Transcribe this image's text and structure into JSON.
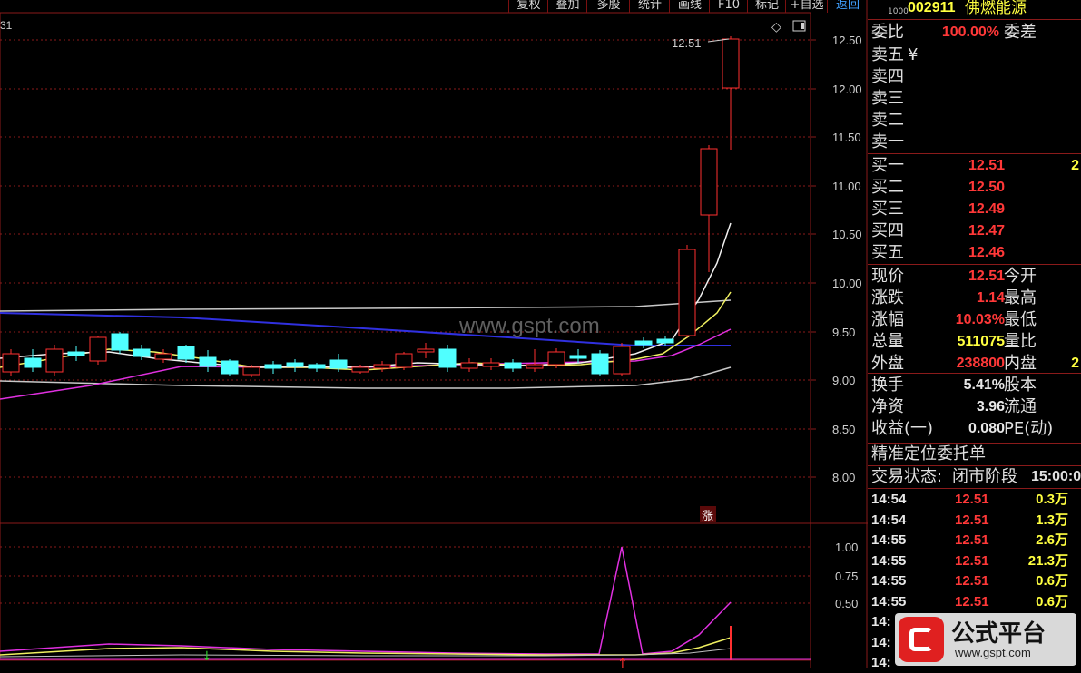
{
  "toolbar": {
    "buttons": [
      "复权",
      "叠加",
      "多股",
      "统计",
      "画线",
      "F10",
      "标记",
      "+自选",
      "返回"
    ]
  },
  "chart": {
    "corner_label": "31",
    "price_ticks": [
      "12.50",
      "12.00",
      "11.50",
      "11.00",
      "10.50",
      "10.00",
      "9.50",
      "9.00",
      "8.50",
      "8.00"
    ],
    "indicator_ticks": [
      "1.00",
      "0.75",
      "0.50"
    ],
    "high_label": "12.51",
    "limit_up_marker": "涨",
    "watermark": "www.gspt.com",
    "colors": {
      "up": "#ff3030",
      "down": "#50ffff",
      "grid": "#8a1a1a"
    }
  },
  "stock": {
    "code_prefix": "1000",
    "code": "002911",
    "name": "佛燃能源"
  },
  "ratio": {
    "label": "委比",
    "value": "100.00%",
    "label2": "委差"
  },
  "sell": [
    {
      "label": "卖五",
      "extra": "¥"
    },
    {
      "label": "卖四",
      "extra": ""
    },
    {
      "label": "卖三",
      "extra": ""
    },
    {
      "label": "卖二",
      "extra": ""
    },
    {
      "label": "卖一",
      "extra": ""
    }
  ],
  "buy": [
    {
      "label": "买一",
      "price": "12.51",
      "vol": "2"
    },
    {
      "label": "买二",
      "price": "12.50",
      "vol": ""
    },
    {
      "label": "买三",
      "price": "12.49",
      "vol": ""
    },
    {
      "label": "买四",
      "price": "12.47",
      "vol": ""
    },
    {
      "label": "买五",
      "price": "12.46",
      "vol": ""
    }
  ],
  "quote": [
    {
      "label": "现价",
      "value": "12.51",
      "label2": "今开",
      "color": "red"
    },
    {
      "label": "涨跌",
      "value": "1.14",
      "label2": "最高",
      "color": "red"
    },
    {
      "label": "涨幅",
      "value": "10.03%",
      "label2": "最低",
      "color": "red"
    },
    {
      "label": "总量",
      "value": "511075",
      "label2": "量比",
      "color": "yellow"
    },
    {
      "label": "外盘",
      "value": "238800",
      "label2": "内盘",
      "color": "red",
      "extra": "2"
    }
  ],
  "fund": [
    {
      "label": "换手",
      "value": "5.41%",
      "label2": "股本"
    },
    {
      "label": "净资",
      "value": "3.96",
      "label2": "流通"
    },
    {
      "label": "收益(一)",
      "value": "0.080",
      "label2": "PE(动)"
    }
  ],
  "order_panel": {
    "title": "精准定位委托单"
  },
  "trade_status": {
    "label": "交易状态:",
    "value": "闭市阶段",
    "time": "15:00:0"
  },
  "ticks": [
    {
      "time": "14:54",
      "price": "12.51",
      "vol": "0.3万"
    },
    {
      "time": "14:54",
      "price": "12.51",
      "vol": "1.3万"
    },
    {
      "time": "14:55",
      "price": "12.51",
      "vol": "2.6万"
    },
    {
      "time": "14:55",
      "price": "12.51",
      "vol": "21.3万"
    },
    {
      "time": "14:55",
      "price": "12.51",
      "vol": "0.6万"
    },
    {
      "time": "14:55",
      "price": "12.51",
      "vol": "0.6万"
    },
    {
      "time": "14:",
      "price": "",
      "vol": ""
    },
    {
      "time": "14:",
      "price": "",
      "vol": ""
    },
    {
      "time": "14:",
      "price": "",
      "vol": ""
    }
  ],
  "logo": {
    "brand": "公式平台",
    "url": "www.gspt.com"
  }
}
